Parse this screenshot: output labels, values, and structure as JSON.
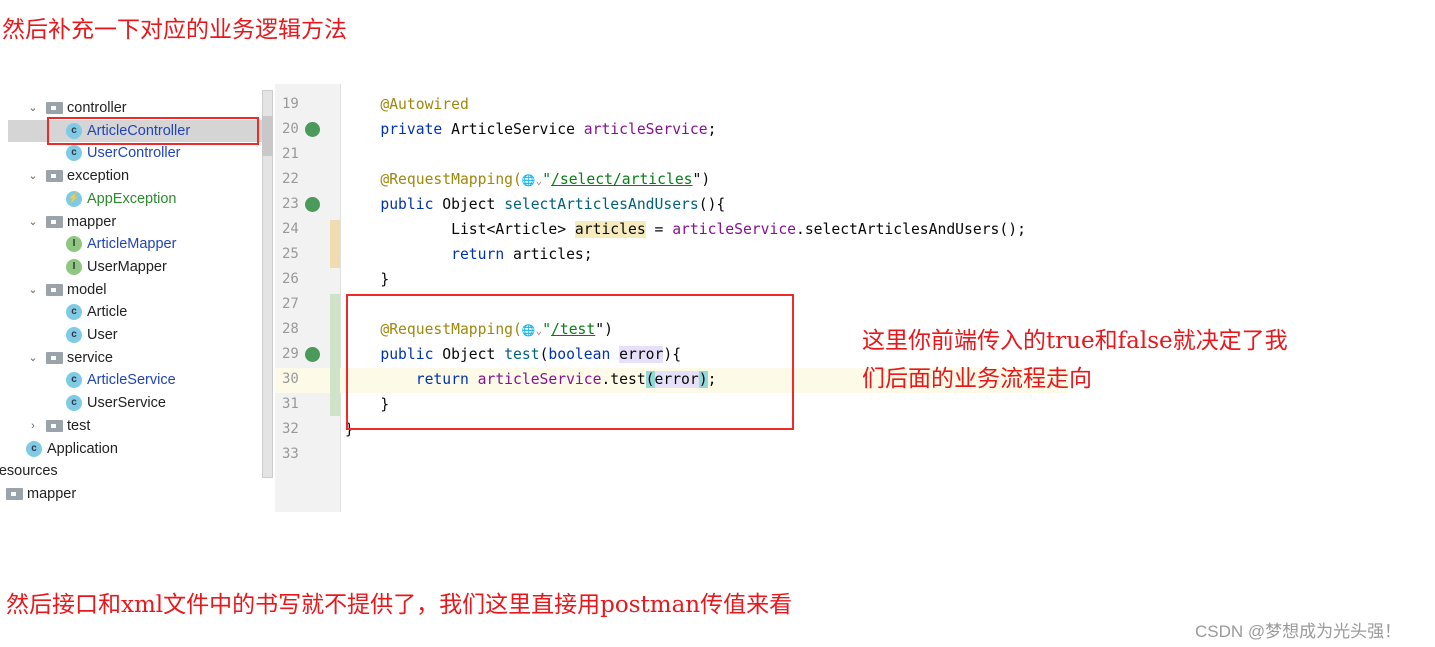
{
  "notes": {
    "top": "然后补充一下对应的业务逻辑方法",
    "right_line1": "这里你前端传入的true和false就决定了我",
    "right_line2": "们后面的业务流程走向",
    "bottom": "然后接口和xml文件中的书写就不提供了，我们这里直接用postman传值来看"
  },
  "watermark": "CSDN @梦想成为光头强！",
  "tree": [
    {
      "label": "controller",
      "type": "folder",
      "indent": 1,
      "expanded": true
    },
    {
      "label": "ArticleController",
      "type": "class",
      "indent": 2,
      "color": "blue",
      "selected": true
    },
    {
      "label": "UserController",
      "type": "class",
      "indent": 2,
      "color": "blue"
    },
    {
      "label": "exception",
      "type": "folder",
      "indent": 1,
      "expanded": true
    },
    {
      "label": "AppException",
      "type": "exception",
      "indent": 2,
      "color": "green"
    },
    {
      "label": "mapper",
      "type": "folder",
      "indent": 1,
      "expanded": true
    },
    {
      "label": "ArticleMapper",
      "type": "interface",
      "indent": 2,
      "color": "blue"
    },
    {
      "label": "UserMapper",
      "type": "interface",
      "indent": 2,
      "color": "dark"
    },
    {
      "label": "model",
      "type": "folder",
      "indent": 1,
      "expanded": true
    },
    {
      "label": "Article",
      "type": "class",
      "indent": 2,
      "color": "dark"
    },
    {
      "label": "User",
      "type": "class",
      "indent": 2,
      "color": "dark"
    },
    {
      "label": "service",
      "type": "folder",
      "indent": 1,
      "expanded": true
    },
    {
      "label": "ArticleService",
      "type": "class",
      "indent": 2,
      "color": "blue"
    },
    {
      "label": "UserService",
      "type": "class",
      "indent": 2,
      "color": "dark"
    },
    {
      "label": "test",
      "type": "folder",
      "indent": 1,
      "expanded": false
    },
    {
      "label": "Application",
      "type": "app",
      "indent": 1,
      "color": "dark"
    },
    {
      "label": "resources",
      "type": "text",
      "indent": 0,
      "color": "dark"
    },
    {
      "label": "mapper",
      "type": "folder",
      "indent": 0,
      "color": "dark"
    }
  ],
  "code": [
    {
      "n": "19",
      "tokens": [
        [
          "    ",
          "pl"
        ],
        [
          "@Autowired",
          "ann"
        ]
      ]
    },
    {
      "n": "20",
      "gutter": "bean-icon",
      "tokens": [
        [
          "    ",
          "pl"
        ],
        [
          "private ",
          "kw"
        ],
        [
          "ArticleService ",
          "pl"
        ],
        [
          "articleService",
          "fld"
        ],
        [
          ";",
          "pl"
        ]
      ]
    },
    {
      "n": "21",
      "tokens": []
    },
    {
      "n": "22",
      "tokens": [
        [
          "    ",
          "pl"
        ],
        [
          "@RequestMapping(",
          "ann"
        ],
        [
          "🌐⌄",
          "glob"
        ],
        [
          "\"",
          "str2"
        ],
        [
          "/select/articles",
          "str"
        ],
        [
          "\")",
          "pl"
        ]
      ]
    },
    {
      "n": "23",
      "gutter": "web-icon",
      "tokens": [
        [
          "    ",
          "pl"
        ],
        [
          "public ",
          "kw"
        ],
        [
          "Object ",
          "pl"
        ],
        [
          "selectArticlesAndUsers",
          "mth"
        ],
        [
          "(){",
          "pl"
        ]
      ]
    },
    {
      "n": "24",
      "tokens": [
        [
          "            ",
          "pl"
        ],
        [
          "List<Article> ",
          "pl"
        ],
        [
          "articles",
          "hl"
        ],
        [
          " = ",
          "pl"
        ],
        [
          "articleService",
          "fld"
        ],
        [
          ".selectArticlesAndUsers();",
          "pl"
        ]
      ]
    },
    {
      "n": "25",
      "tokens": [
        [
          "            ",
          "pl"
        ],
        [
          "return ",
          "kw"
        ],
        [
          "articles;",
          "pl"
        ]
      ]
    },
    {
      "n": "26",
      "tokens": [
        [
          "    ",
          "pl"
        ],
        [
          "}",
          "pl"
        ]
      ]
    },
    {
      "n": "27",
      "tokens": []
    },
    {
      "n": "28",
      "tokens": [
        [
          "    ",
          "pl"
        ],
        [
          "@RequestMapping(",
          "ann"
        ],
        [
          "🌐⌄",
          "glob"
        ],
        [
          "\"",
          "str2"
        ],
        [
          "/test",
          "str"
        ],
        [
          "\")",
          "pl"
        ]
      ]
    },
    {
      "n": "29",
      "gutter": "web-icon",
      "tokens": [
        [
          "    ",
          "pl"
        ],
        [
          "public ",
          "kw"
        ],
        [
          "Object ",
          "pl"
        ],
        [
          "test",
          "mth"
        ],
        [
          "(",
          "pl"
        ],
        [
          "boolean ",
          "kw"
        ],
        [
          "error",
          "hp"
        ],
        [
          "){",
          "pl"
        ]
      ]
    },
    {
      "n": "30",
      "tokens": [
        [
          "        ",
          "pl"
        ],
        [
          "return ",
          "kw"
        ],
        [
          "articleService",
          "fld"
        ],
        [
          ".test",
          "pl"
        ],
        [
          "(",
          "br"
        ],
        [
          "error",
          "hp"
        ],
        [
          ")",
          "br"
        ],
        [
          ";",
          "pl"
        ]
      ]
    },
    {
      "n": "31",
      "tokens": [
        [
          "    ",
          "pl"
        ],
        [
          "}",
          "pl"
        ]
      ]
    },
    {
      "n": "32",
      "tokens": [
        [
          "}",
          "pl"
        ]
      ]
    },
    {
      "n": "33",
      "tokens": []
    }
  ]
}
